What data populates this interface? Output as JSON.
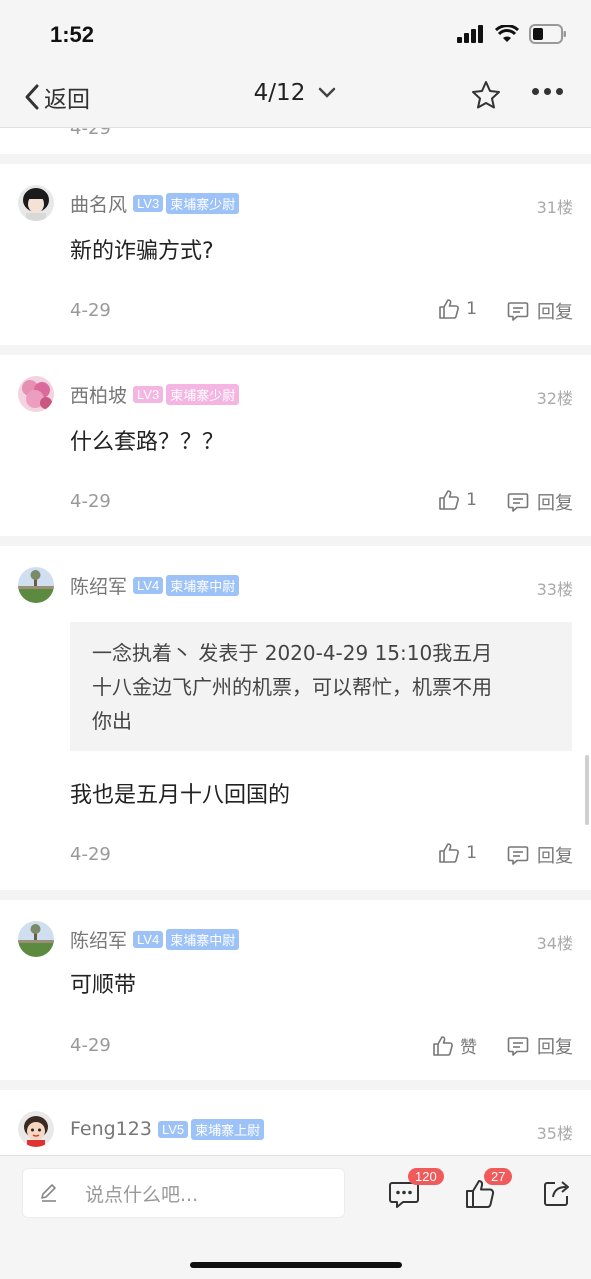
{
  "status_bar": {
    "time": "1:52"
  },
  "nav": {
    "back_label": "返回",
    "page_indicator": "4/12"
  },
  "prev_stub": {
    "date": "4-29"
  },
  "posts": [
    {
      "username": "曲名风",
      "level": "LV3",
      "rank": "柬埔寨少尉",
      "floor": "31楼",
      "text": "新的诈骗方式?",
      "date": "4-29",
      "likes": "1",
      "reply_label": "回复"
    },
    {
      "username": "西柏坡",
      "level": "LV3",
      "rank": "柬埔寨少尉",
      "floor": "32楼",
      "text": "什么套路？？？",
      "date": "4-29",
      "likes": "1",
      "reply_label": "回复"
    },
    {
      "username": "陈绍军",
      "level": "LV4",
      "rank": "柬埔寨中尉",
      "floor": "33楼",
      "quote_lines": [
        "一念执着丶 发表于 2020-4-29 15:10我五月",
        "十八金边飞广州的机票，可以帮忙，机票不用",
        "你出"
      ],
      "text": "我也是五月十八回国的",
      "date": "4-29",
      "likes": "1",
      "reply_label": "回复"
    },
    {
      "username": "陈绍军",
      "level": "LV4",
      "rank": "柬埔寨中尉",
      "floor": "34楼",
      "text": "可顺带",
      "date": "4-29",
      "likes": "赞",
      "reply_label": "回复"
    },
    {
      "username": "Feng123",
      "level": "LV5",
      "rank": "柬埔寨上尉",
      "floor": "35楼"
    }
  ],
  "bottom_bar": {
    "input_placeholder": "说点什么吧...",
    "comments_count": "120",
    "likes_count": "27"
  },
  "colors": {
    "level_blue": "#9cc2f7",
    "level_pink": "#f4b5e3",
    "badge_red": "#f05a5a"
  }
}
